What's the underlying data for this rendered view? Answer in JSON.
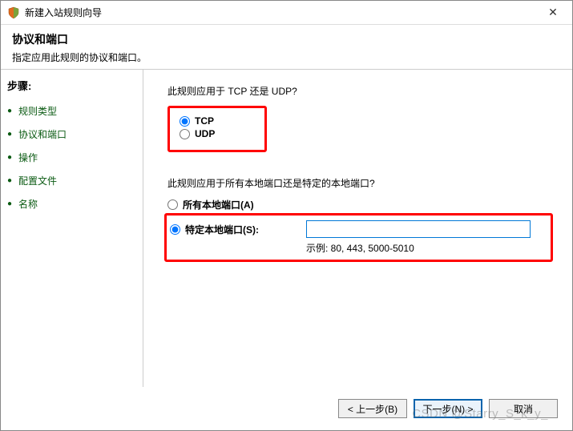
{
  "window": {
    "title": "新建入站规则向导",
    "close": "✕"
  },
  "header": {
    "title": "协议和端口",
    "subtitle": "指定应用此规则的协议和端口。"
  },
  "sidebar": {
    "steps_label": "步骤:",
    "items": [
      {
        "label": "规则类型"
      },
      {
        "label": "协议和端口"
      },
      {
        "label": "操作"
      },
      {
        "label": "配置文件"
      },
      {
        "label": "名称"
      }
    ]
  },
  "main": {
    "q1": "此规则应用于 TCP 还是 UDP?",
    "protocol": {
      "tcp": "TCP",
      "udp": "UDP"
    },
    "q2": "此规则应用于所有本地端口还是特定的本地端口?",
    "port_all": "所有本地端口(A)",
    "port_specific": "特定本地端口(S):",
    "port_value": "",
    "example": "示例: 80, 443, 5000-5010"
  },
  "footer": {
    "back": "< 上一步(B)",
    "next": "下一步(N) >",
    "cancel": "取消"
  },
  "watermark": "CSDN @Starry_S_k_y_"
}
